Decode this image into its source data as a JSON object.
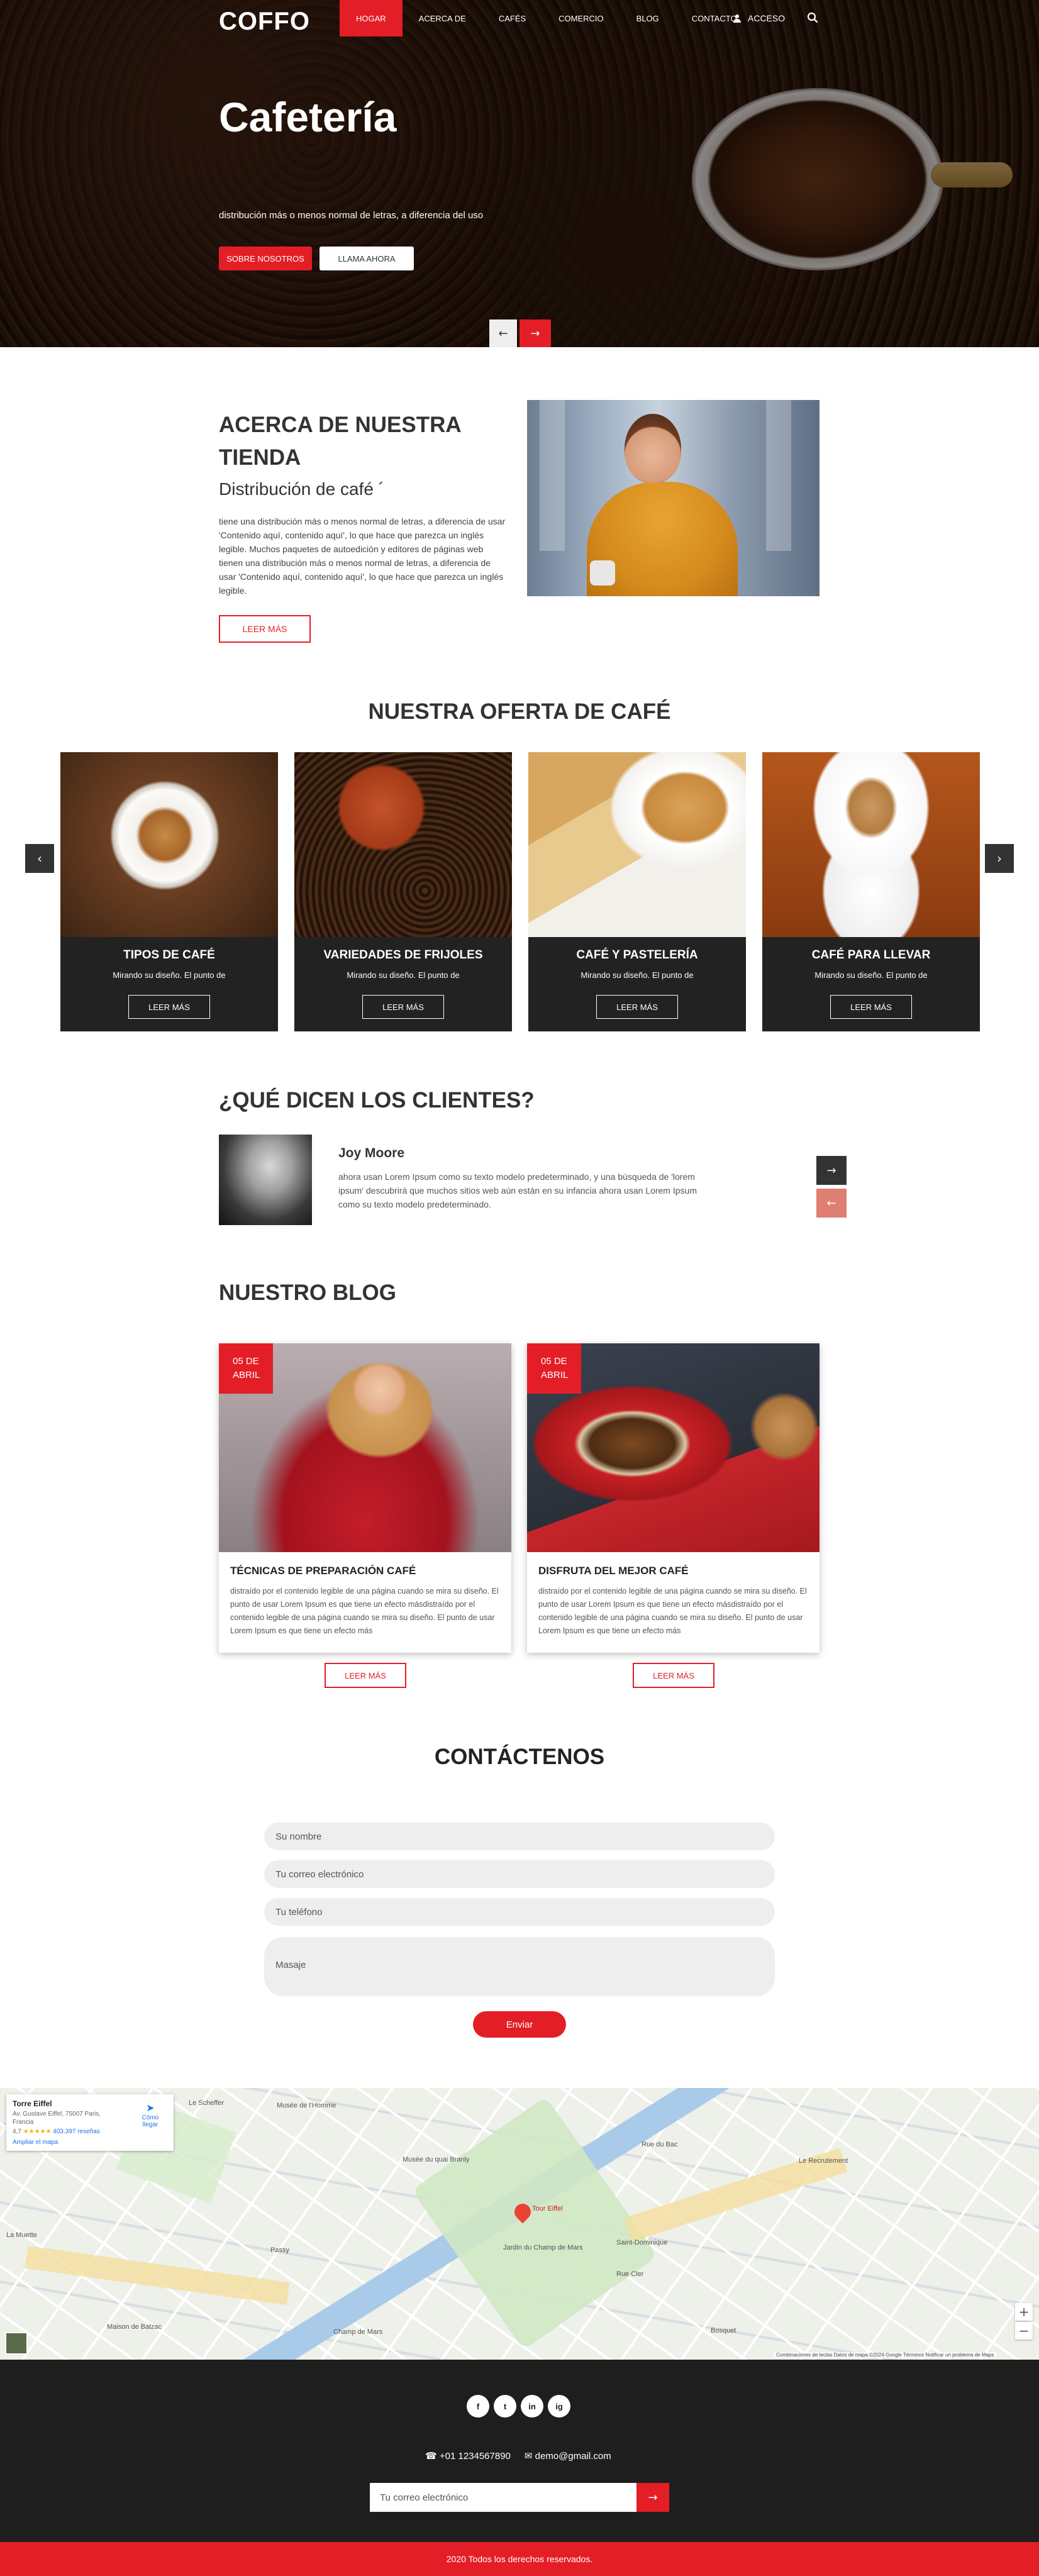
{
  "header": {
    "logo": "COFFO",
    "nav": [
      "HOGAR",
      "ACERCA DE",
      "CAFÉS",
      "COMERCIO",
      "BLOG",
      "CONTACTO"
    ],
    "login": "ACCESO"
  },
  "hero": {
    "title": "Cafetería",
    "subtitle": "distribución más o menos normal de letras, a diferencia del uso",
    "btn_about": "SOBRE NOSOTROS",
    "btn_call": "LLAMA AHORA"
  },
  "about": {
    "title": "ACERCA DE NUESTRA TIENDA",
    "subtitle": "Distribución de café ´",
    "text": "tiene una distribución más o menos normal de letras, a diferencia de usar 'Contenido aquí, contenido aquí', lo que hace que parezca un inglés legible. Muchos paquetes de autoedición y editores de páginas web tienen una distribución más o menos normal de letras, a diferencia de usar 'Contenido aquí, contenido aquí', lo que hace que parezca un inglés legible.",
    "button": "LEER MÁS"
  },
  "offer": {
    "title": "NUESTRA OFERTA DE CAFÉ",
    "items": [
      {
        "name": "TIPOS DE CAFÉ",
        "desc": "Mirando su diseño. El punto de",
        "button": "LEER MÁS"
      },
      {
        "name": "VARIEDADES DE FRIJOLES",
        "desc": "Mirando su diseño. El punto de",
        "button": "LEER MÁS"
      },
      {
        "name": "CAFÉ Y PASTELERÍA",
        "desc": "Mirando su diseño. El punto de",
        "button": "LEER MÁS"
      },
      {
        "name": "CAFÉ PARA LLEVAR",
        "desc": "Mirando su diseño. El punto de",
        "button": "LEER MÁS"
      }
    ]
  },
  "testimonial": {
    "title": "¿QUÉ DICEN LOS CLIENTES?",
    "name": "Joy Moore",
    "text": "ahora usan Lorem Ipsum como su texto modelo predeterminado, y una búsqueda de 'lorem ipsum' descubrirá que muchos sitios web aún están en su infancia ahora usan Lorem Ipsum como su texto modelo predeterminado."
  },
  "blog": {
    "title": "NUESTRO BLOG",
    "posts": [
      {
        "day": "05 DE",
        "month": "ABRIL",
        "title": "TÉCNICAS DE PREPARACIÓN CAFÉ",
        "text": "distraído por el contenido legible de una página cuando se mira su diseño. El punto de usar Lorem Ipsum es que tiene un efecto másdistraído por el contenido legible de una página cuando se mira su diseño. El punto de usar Lorem Ipsum es que tiene un efecto más",
        "button": "LEER MÁS"
      },
      {
        "day": "05 DE",
        "month": "ABRIL",
        "title": "DISFRUTA DEL MEJOR CAFÉ",
        "text": "distraído por el contenido legible de una página cuando se mira su diseño. El punto de usar Lorem Ipsum es que tiene un efecto másdistraído por el contenido legible de una página cuando se mira su diseño. El punto de usar Lorem Ipsum es que tiene un efecto más",
        "button": "LEER MÁS"
      }
    ]
  },
  "contact": {
    "title": "CONTÁCTENOS",
    "name_placeholder": "Su nombre",
    "email_placeholder": "Tu correo electrónico",
    "phone_placeholder": "Tu teléfono",
    "message_placeholder": "Masaje",
    "send": "Enviar"
  },
  "map": {
    "place_name": "Torre Eiffel",
    "address": "Av. Gustave Eiffel, 75007 Paris, Francia",
    "rating": "4,7",
    "stars": "★★★★★",
    "reviews": "403.397 reseñas",
    "enlarge": "Ampliar el mapa",
    "directions": "Cómo llegar",
    "pin_label": "Tour Eiffel",
    "labels": [
      "Le Scheffer",
      "Musée de l'Homme",
      "La Muette",
      "Passy",
      "Maison de Balzac",
      "Champ de Mars",
      "Rue Cler",
      "Saint-Dominique",
      "Bosquet",
      "Le Recrutement",
      "Rue du Bac",
      "Jardin du Champ de Mars",
      "Musée du quai Branly"
    ],
    "footer": "Combinaciones de teclas   Datos de mapa ©2024 Google   Términos   Notificar un problema de Maps",
    "zoom_in": "+",
    "zoom_out": "−"
  },
  "footer": {
    "social": [
      "f",
      "t",
      "in",
      "ig"
    ],
    "phone": "+01 1234567890",
    "email": "demo@gmail.com",
    "newsletter_placeholder": "Tu correo electrónico",
    "copyright": "2020 Todos los derechos reservados."
  },
  "colors": {
    "accent": "#e41e26",
    "dark": "#1e1e1e"
  }
}
